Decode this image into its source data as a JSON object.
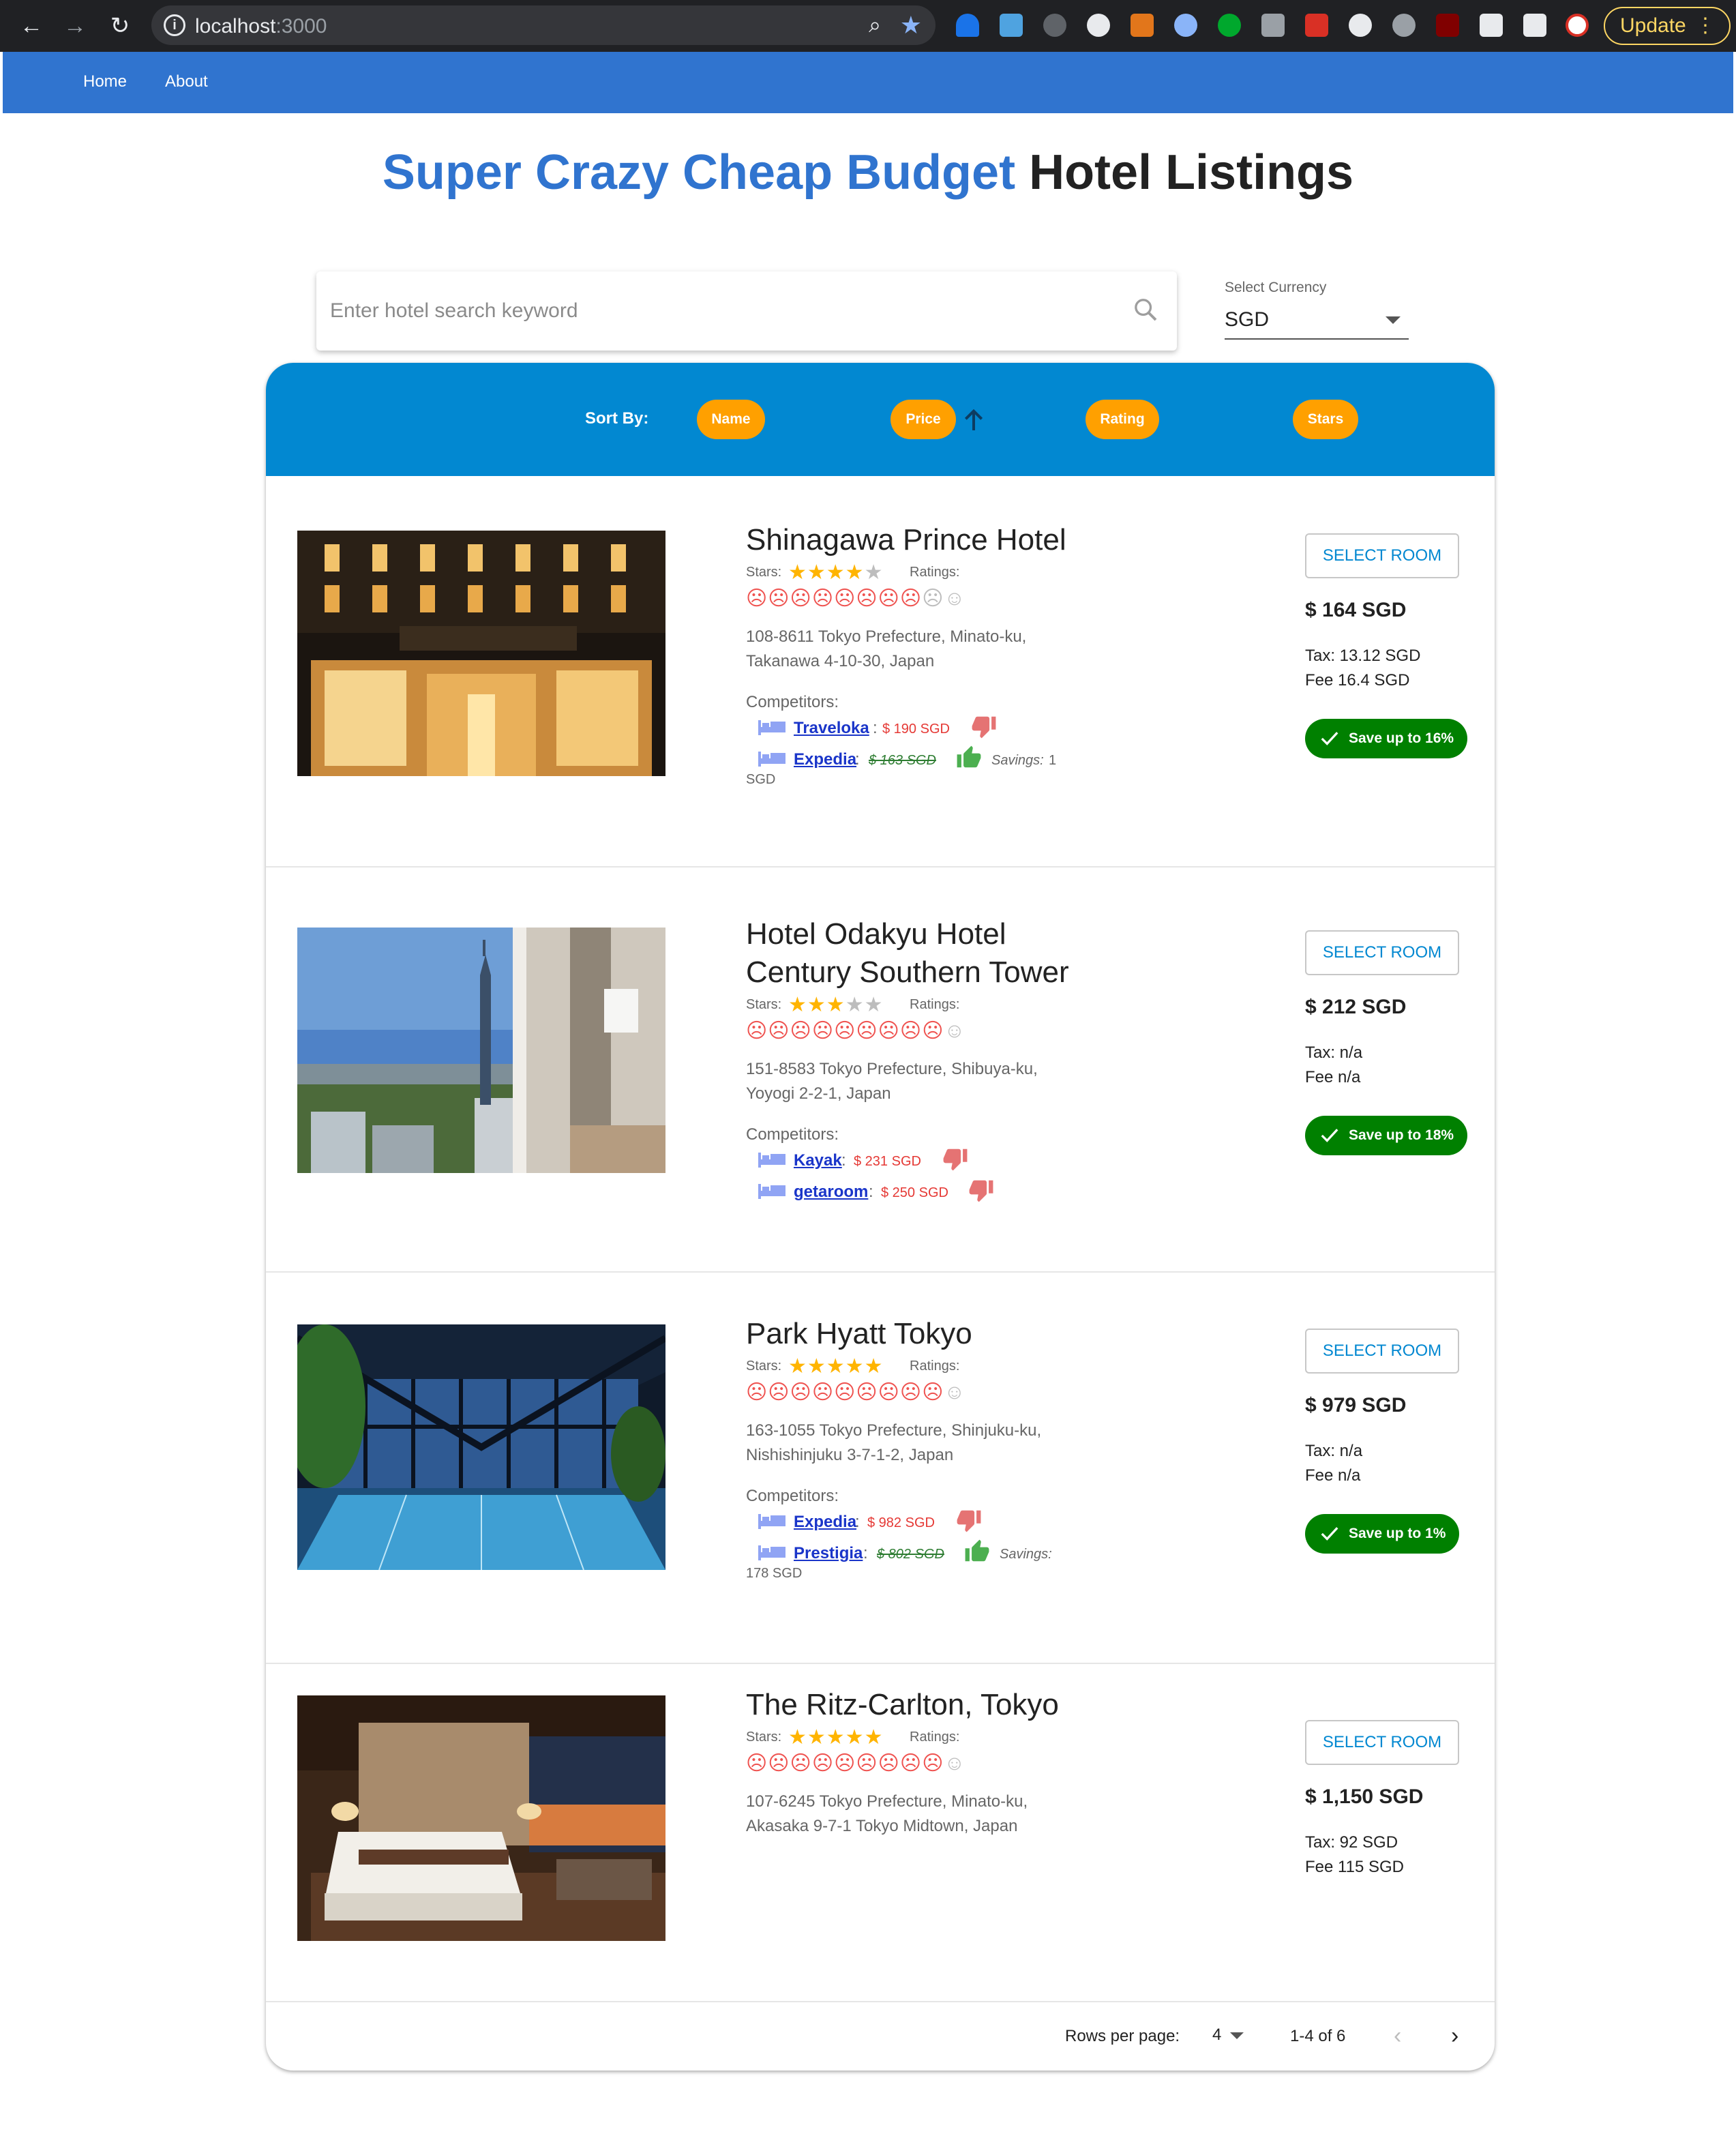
{
  "browser": {
    "url_host": "localhost",
    "url_port": ":3000",
    "update_label": "Update"
  },
  "nav": {
    "home": "Home",
    "about": "About"
  },
  "title": {
    "accent": "Super Crazy Cheap Budget",
    "rest": " Hotel Listings"
  },
  "search": {
    "placeholder": "Enter hotel search keyword"
  },
  "currency": {
    "label": "Select Currency",
    "value": "SGD"
  },
  "sort": {
    "label": "Sort By:",
    "chips": [
      "Name",
      "Price",
      "Rating",
      "Stars"
    ],
    "active": "Price",
    "direction": "ascending"
  },
  "labels": {
    "stars": "Stars:",
    "ratings": "Ratings:",
    "competitors": "Competitors:",
    "select_room": "SELECT ROOM",
    "savings": "Savings:"
  },
  "hotels": [
    {
      "name": "Shinagawa Prince Hotel",
      "stars": 4,
      "rating": 8,
      "address_line1": "108-8611 Tokyo Prefecture, Minato-ku,",
      "address_line2": "Takanawa 4-10-30, Japan",
      "competitors": [
        {
          "site": "Traveloka",
          "price": "$ 190  SGD",
          "cheaper": false
        },
        {
          "site": "Expedia",
          "price": "$ 163  SGD",
          "cheaper": true,
          "savings": "1",
          "savings_unit": "SGD"
        }
      ],
      "price": "$ 164 SGD",
      "tax": "Tax: 13.12 SGD",
      "fee": "Fee 16.4 SGD",
      "save": "Save up to 16%"
    },
    {
      "name_line1": "Hotel Odakyu Hotel",
      "name_line2": "Century Southern Tower",
      "stars": 3,
      "rating": 9,
      "address_line1": "151-8583 Tokyo Prefecture, Shibuya-ku,",
      "address_line2": "Yoyogi 2-2-1, Japan",
      "competitors": [
        {
          "site": "Kayak",
          "price": "$ 231  SGD",
          "cheaper": false
        },
        {
          "site": "getaroom",
          "price": "$ 250  SGD",
          "cheaper": false
        }
      ],
      "price": "$ 212 SGD",
      "tax": "Tax: n/a",
      "fee": "Fee n/a",
      "save": "Save up to 18%"
    },
    {
      "name": "Park Hyatt Tokyo",
      "stars": 5,
      "rating": 9,
      "address_line1": "163-1055 Tokyo Prefecture, Shinjuku-ku,",
      "address_line2": "Nishishinjuku 3-7-1-2, Japan",
      "competitors": [
        {
          "site": "Expedia",
          "price": "$ 982  SGD",
          "cheaper": false
        },
        {
          "site": "Prestigia",
          "price": "$ 802  SGD",
          "cheaper": true,
          "savings": "",
          "savings_unit": "178 SGD"
        }
      ],
      "price": "$ 979 SGD",
      "tax": "Tax: n/a",
      "fee": "Fee n/a",
      "save": "Save up to 1%"
    },
    {
      "name": "The Ritz-Carlton, Tokyo",
      "stars": 5,
      "rating": 9,
      "address_line1": "107-6245 Tokyo Prefecture, Minato-ku,",
      "address_line2": "Akasaka 9-7-1 Tokyo Midtown, Japan",
      "price": "$ 1,150 SGD",
      "tax": "Tax: 92 SGD",
      "fee": "Fee 115 SGD"
    }
  ],
  "pagination": {
    "rows_per_page_label": "Rows per page:",
    "rows_per_page": "4",
    "range": "1-4 of 6"
  },
  "colors": {
    "appbar": "#3074cf",
    "sortbar": "#0288d1",
    "chip": "#ffa000",
    "save_badge": "#008000",
    "star": "#ffb400",
    "rating_face": "#ef5350"
  }
}
